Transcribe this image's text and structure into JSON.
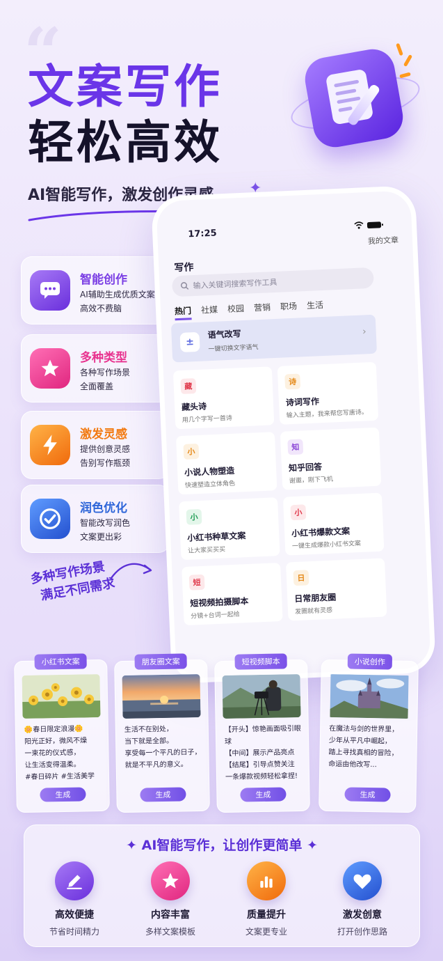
{
  "hero": {
    "title_line1": "文案写作",
    "title_line2": "轻松高效",
    "subtitle": "AI智能写作，激发创作灵感"
  },
  "features": [
    {
      "title": "智能创作",
      "desc": "AI辅助生成优质文案\n高效不费脑",
      "color": "#7b3fe4",
      "icon": "chat-bubble-icon"
    },
    {
      "title": "多种类型",
      "desc": "各种写作场景\n全面覆盖",
      "color": "#e8338f",
      "icon": "star-icon"
    },
    {
      "title": "激发灵感",
      "desc": "提供创意灵感\n告别写作瓶颈",
      "color": "#f27a12",
      "icon": "lightning-icon"
    },
    {
      "title": "润色优化",
      "desc": "智能改写润色\n文案更出彩",
      "color": "#2f66d9",
      "icon": "check-circle-icon"
    }
  ],
  "phone": {
    "time": "17:25",
    "my_articles": "我的文章",
    "page_title": "写作",
    "search_placeholder": "输入关键词搜索写作工具",
    "tabs": [
      "热门",
      "社媒",
      "校园",
      "营销",
      "职场",
      "生活"
    ],
    "hero_card": {
      "title": "语气改写",
      "desc": "一键切换文字语气",
      "icon": "text-tone-icon"
    },
    "cards": [
      {
        "badge": "藏",
        "title": "藏头诗",
        "desc": "用几个字写一首诗",
        "color": "#e0394b",
        "bg": "#fde8ea"
      },
      {
        "badge": "诗",
        "title": "诗词写作",
        "desc": "输入主题，我来帮您写唐诗。",
        "color": "#e58a1a",
        "bg": "#fdf1e0"
      },
      {
        "badge": "小",
        "title": "小说人物塑造",
        "desc": "快速塑造立体角色",
        "color": "#e58a1a",
        "bg": "#fdf1e0"
      },
      {
        "badge": "知",
        "title": "知乎回答",
        "desc": "谢邀，刚下飞机",
        "color": "#8b45d6",
        "bg": "#f1e6fb"
      },
      {
        "badge": "小",
        "title": "小红书种草文案",
        "desc": "让大家买买买",
        "color": "#1f9d55",
        "bg": "#e3f6ea"
      },
      {
        "badge": "小",
        "title": "小红书爆款文案",
        "desc": "一键生成爆款小红书文案",
        "color": "#e0394b",
        "bg": "#fde8ea"
      },
      {
        "badge": "短",
        "title": "短视频拍摄脚本",
        "desc": "分镜+台词一起给",
        "color": "#e0394b",
        "bg": "#fde8ea"
      },
      {
        "badge": "日",
        "title": "日常朋友圈",
        "desc": "发圈就有灵感",
        "color": "#e58a1a",
        "bg": "#fdf1e0"
      }
    ]
  },
  "scenario_note": {
    "line1": "多种写作场景",
    "line2": "满足不同需求"
  },
  "posts": [
    {
      "tag": "小红书文案",
      "text": "🌼春日限定浪漫🌼\n阳光正好，微风不燥\n一束花的仪式感，\n让生活变得温柔。\n#春日碎片 #生活美学",
      "button": "生成",
      "image": "yellow-flowers"
    },
    {
      "tag": "朋友圈文案",
      "text": "生活不在别处，\n当下就是全部。\n享受每一个平凡的日子，\n就是不平凡的意义。",
      "button": "生成",
      "image": "sunset-sea"
    },
    {
      "tag": "短视频脚本",
      "text": "【开头】惊艳画面吸引眼球\n【中间】展示产品亮点\n【结尾】引导点赞关注\n一条爆款视频轻松拿捏!",
      "button": "生成",
      "image": "cameraman"
    },
    {
      "tag": "小说创作",
      "text": "在魔法与剑的世界里，\n少年从平凡中崛起，\n踏上寻找真相的冒险，\n命运由他改写...",
      "button": "生成",
      "image": "fantasy-castle"
    }
  ],
  "bottom": {
    "title": "AI智能写作，让创作更简单",
    "items": [
      {
        "title": "高效便捷",
        "desc": "节省时间精力",
        "color": "#7b3fe4",
        "icon": "pen-icon"
      },
      {
        "title": "内容丰富",
        "desc": "多样文案模板",
        "color": "#e8338f",
        "icon": "star-icon"
      },
      {
        "title": "质量提升",
        "desc": "文案更专业",
        "color": "#f27a12",
        "icon": "bar-chart-icon"
      },
      {
        "title": "激发创意",
        "desc": "打开创作思路",
        "color": "#2f66d9",
        "icon": "heart-icon"
      }
    ]
  }
}
